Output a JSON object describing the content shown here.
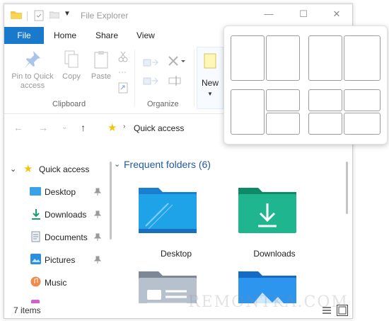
{
  "window": {
    "title": "File Explorer"
  },
  "menu": {
    "file": "File",
    "tabs": [
      "Home",
      "Share",
      "View"
    ]
  },
  "ribbon": {
    "pin_label": "Pin to Quick access",
    "copy_label": "Copy",
    "paste_label": "Paste",
    "new_label": "New",
    "groups": {
      "clipboard": "Clipboard",
      "organize": "Organize"
    }
  },
  "address": {
    "location": "Quick access"
  },
  "nav_pane": {
    "quick_access": "Quick access",
    "items": [
      {
        "label": "Desktop",
        "pinned": true
      },
      {
        "label": "Downloads",
        "pinned": true
      },
      {
        "label": "Documents",
        "pinned": true
      },
      {
        "label": "Pictures",
        "pinned": true
      },
      {
        "label": "Music",
        "pinned": false
      }
    ]
  },
  "content": {
    "section": "Frequent folders (6)",
    "folders": [
      "Desktop",
      "Downloads"
    ]
  },
  "status": {
    "items": "7 items"
  },
  "watermark": "REMONTKA.COM",
  "colors": {
    "accent": "#1979ca",
    "folder_blue": "#1fa3e8",
    "folder_green": "#1fb58e"
  }
}
